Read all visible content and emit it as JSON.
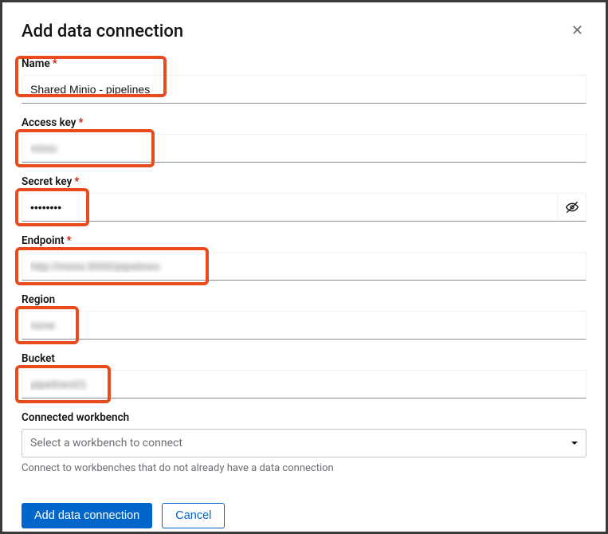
{
  "modal": {
    "title": "Add data connection"
  },
  "fields": {
    "name": {
      "label": "Name",
      "value": "Shared Minio - pipelines"
    },
    "accessKey": {
      "label": "Access key",
      "value": "minio"
    },
    "secretKey": {
      "label": "Secret key",
      "value": "••••••••"
    },
    "endpoint": {
      "label": "Endpoint",
      "value": "http://minio:9000/pipelines"
    },
    "region": {
      "label": "Region",
      "value": "none"
    },
    "bucket": {
      "label": "Bucket",
      "value": "pipelines01"
    }
  },
  "connectedWorkbench": {
    "label": "Connected workbench",
    "placeholder": "Select a workbench to connect",
    "helper": "Connect to workbenches that do not already have a data connection"
  },
  "buttons": {
    "primary": "Add data connection",
    "secondary": "Cancel"
  }
}
